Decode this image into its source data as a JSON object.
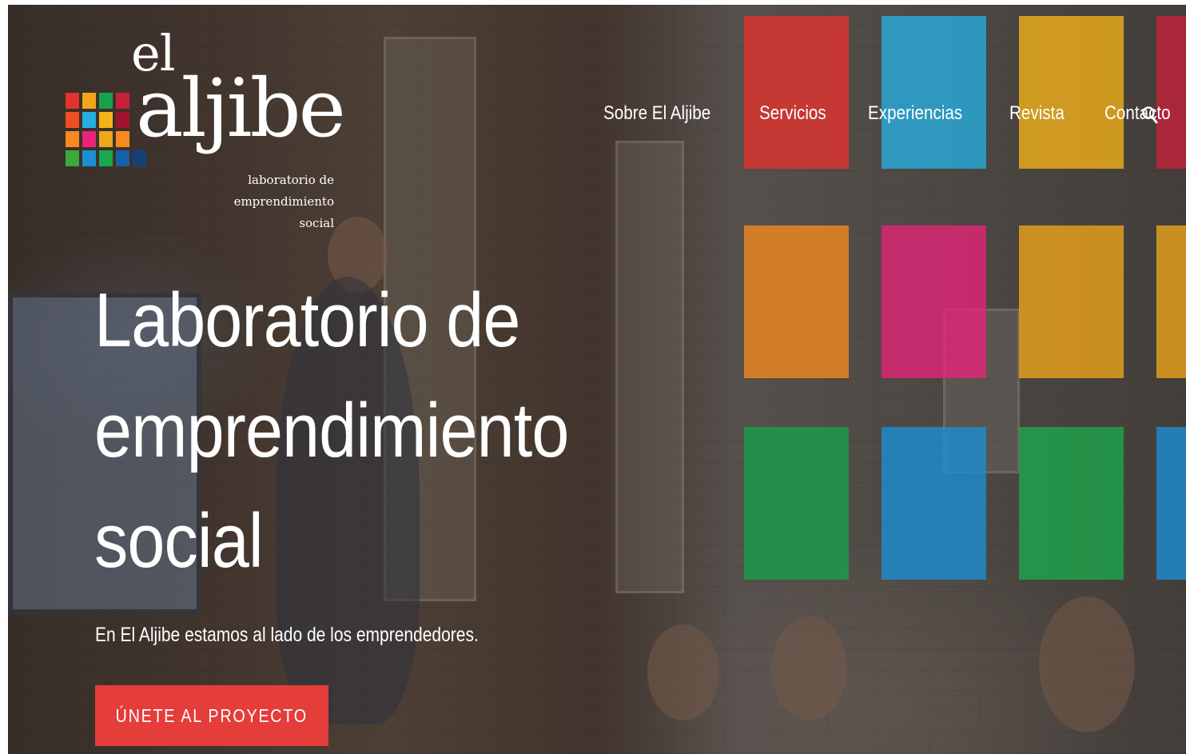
{
  "colors": {
    "accent": "#e53d3a",
    "tiles": [
      "#e5322d",
      "#26aee0",
      "#f5b21a",
      "#c8213b",
      "#f68a1f",
      "#e7247a",
      "#f0a51a",
      "#17a24a",
      "#1a8fd6",
      "#1ba94c"
    ]
  },
  "logo": {
    "el": "el",
    "aljibe": "aljibe",
    "tagline": [
      "laboratorio de",
      "emprendimiento",
      "social"
    ]
  },
  "nav": {
    "items": [
      "Sobre El Aljibe",
      "Servicios",
      "Experiencias",
      "Revista",
      "Contacto"
    ],
    "search_icon": "search-icon"
  },
  "hero": {
    "title_lines": [
      "Laboratorio de",
      "emprendimiento",
      "social"
    ],
    "subtitle": "En El Aljibe estamos al lado de los emprendedores.",
    "cta_label": "ÚNETE AL PROYECTO"
  }
}
